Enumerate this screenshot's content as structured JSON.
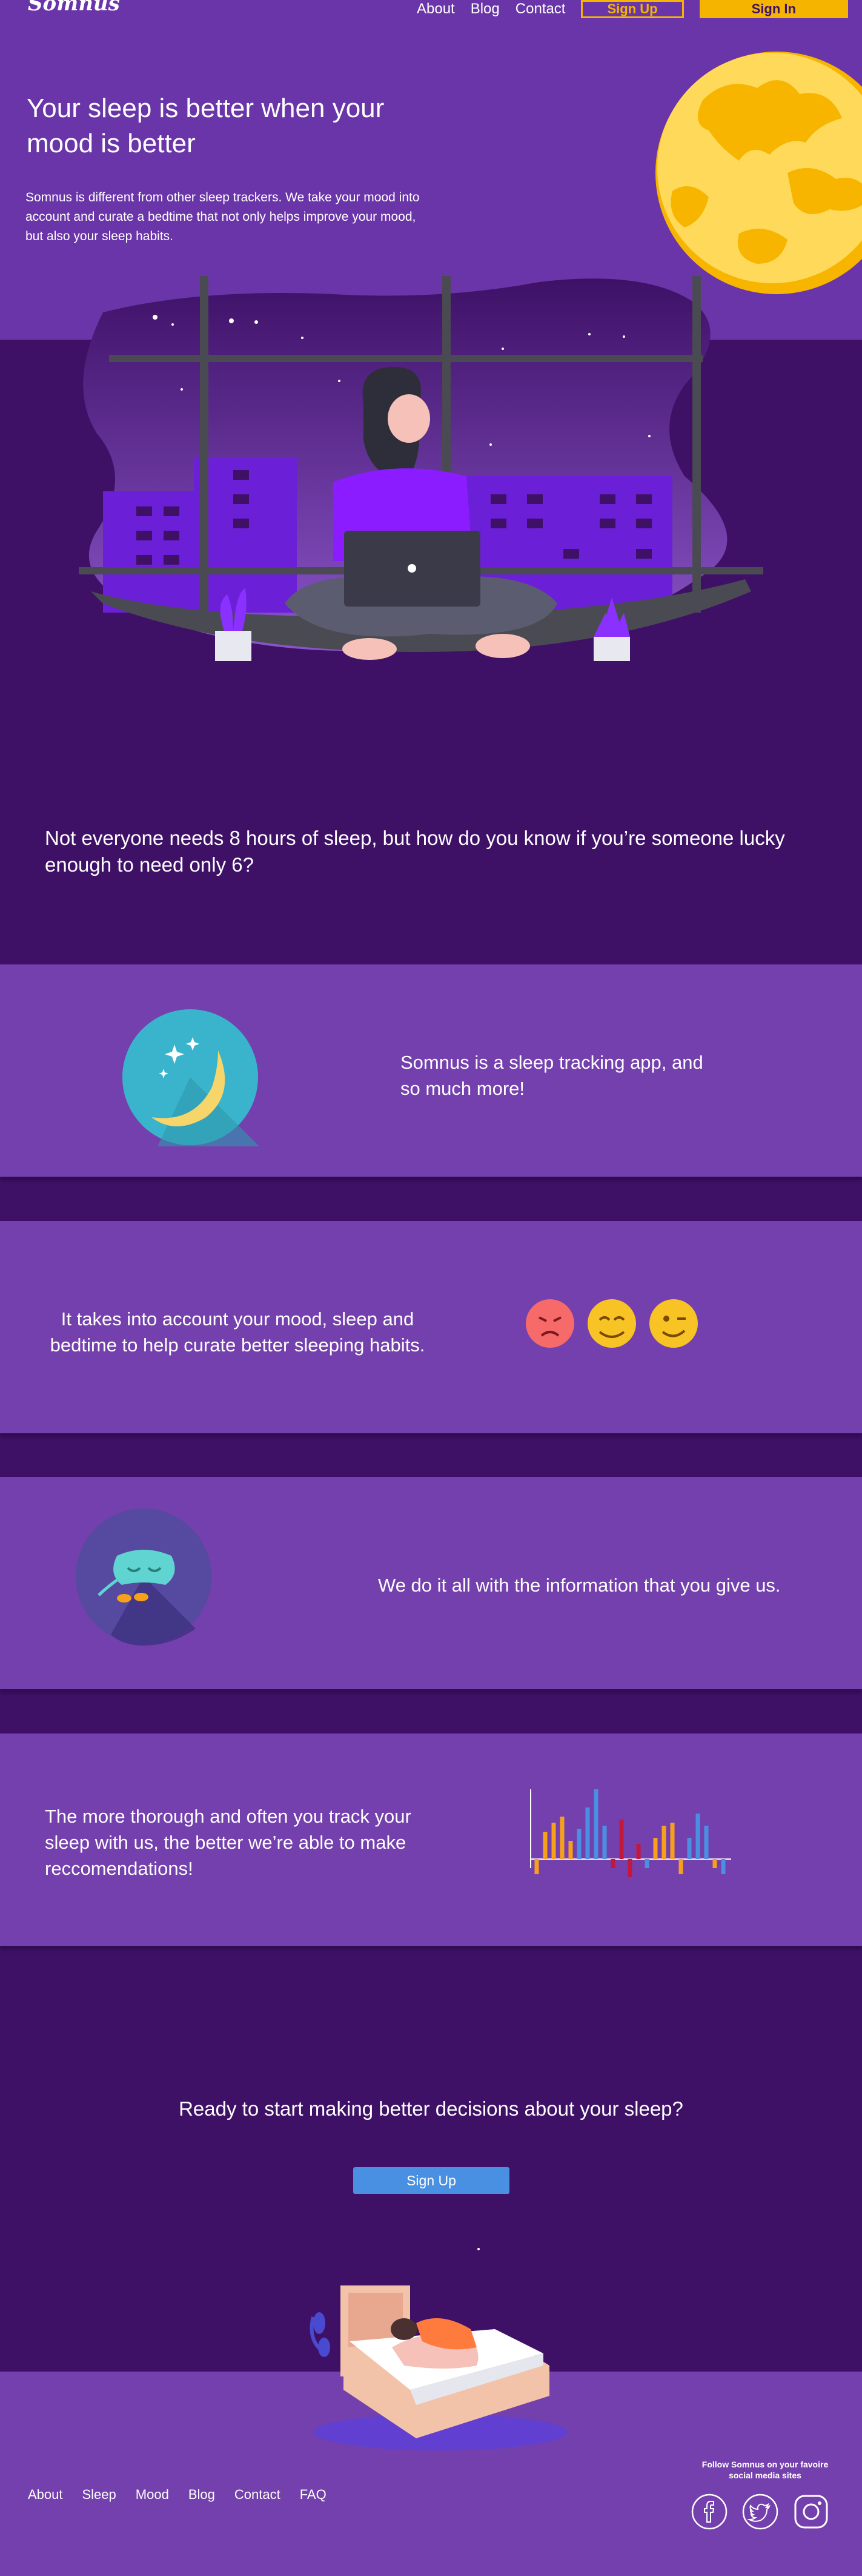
{
  "header": {
    "logo": "Somnus",
    "nav": [
      "About",
      "Blog",
      "Contact"
    ],
    "signup_label": "Sign Up",
    "signin_label": "Sign In"
  },
  "hero": {
    "title": "Your sleep is better when your mood is better",
    "description": "Somnus is different from other sleep trackers. We take your mood into account and curate a bedtime that not only helps improve your mood, but also your sleep habits."
  },
  "intro": {
    "text": "Not everyone needs 8 hours of sleep, but how do you know if you’re someone lucky enough to need only 6?"
  },
  "features": [
    {
      "text": "Somnus is a sleep tracking app, and so much more!",
      "icon": "crescent-moon-icon"
    },
    {
      "text": "It takes into account your mood, sleep and bedtime to help curate better sleeping habits.",
      "icon": "mood-faces-icon"
    },
    {
      "text": "We do it all with the information that you give us.",
      "icon": "sleep-mask-icon"
    },
    {
      "text": "The more thorough and often you track your sleep with us, the better we’re able to make reccomendations!",
      "icon": "sleep-chart-icon"
    }
  ],
  "cta": {
    "text": "Ready to start making better decisions about your sleep?",
    "button_label": "Sign Up"
  },
  "footer": {
    "links": [
      "About",
      "Sleep",
      "Mood",
      "Blog",
      "Contact",
      "FAQ"
    ],
    "social_caption": "Follow Somnus on your favoire social media sites",
    "social_icons": [
      "facebook-icon",
      "twitter-icon",
      "instagram-icon"
    ]
  },
  "colors": {
    "deep_purple": "#3e1167",
    "band_purple": "#7440ad",
    "accent_yellow": "#f4b400",
    "button_blue": "#4a90e2"
  }
}
